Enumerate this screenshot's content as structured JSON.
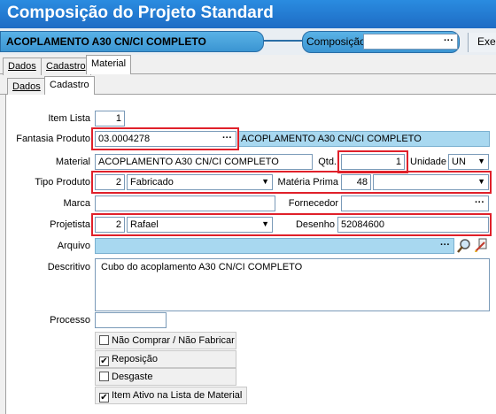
{
  "window": {
    "title": "Composição do Projeto Standard"
  },
  "header": {
    "product_name": "ACOPLAMENTO A30 CN/CI COMPLETO",
    "composicao_label": "Composição",
    "composicao_value": "",
    "composicao_browse": "···",
    "exec_label": "Exec"
  },
  "tabs": {
    "main": [
      "Dados",
      "Cadastro",
      "Material"
    ],
    "sub": [
      "Dados",
      "Cadastro"
    ]
  },
  "form": {
    "item_lista": {
      "label": "Item Lista",
      "value": "1"
    },
    "fantasia_produto": {
      "label": "Fantasia Produto",
      "value": "03.0004278",
      "browse": "···",
      "description": "ACOPLAMENTO A30 CN/CI COMPLETO"
    },
    "material": {
      "label": "Material",
      "value": "ACOPLAMENTO A30 CN/CI COMPLETO"
    },
    "qtd": {
      "label": "Qtd.",
      "value": "1"
    },
    "unidade": {
      "label": "Unidade",
      "value": "UN"
    },
    "tipo_produto": {
      "label": "Tipo Produto",
      "code": "2",
      "value": "Fabricado"
    },
    "materia_prima": {
      "label": "Matéria Prima",
      "code": "48",
      "value": ""
    },
    "marca": {
      "label": "Marca",
      "value": ""
    },
    "fornecedor": {
      "label": "Fornecedor",
      "value": "",
      "browse": "···"
    },
    "projetista": {
      "label": "Projetista",
      "code": "2",
      "value": "Rafael"
    },
    "desenho": {
      "label": "Desenho",
      "value": "52084600"
    },
    "arquivo": {
      "label": "Arquivo",
      "value": "",
      "browse": "···"
    },
    "descritivo": {
      "label": "Descritivo",
      "value": "Cubo do acoplamento A30 CN/CI COMPLETO"
    },
    "processo": {
      "label": "Processo",
      "value": ""
    }
  },
  "checkboxes": [
    {
      "label": "Não Comprar / Não Fabricar",
      "checked": false,
      "mark": ""
    },
    {
      "label": "Reposição",
      "checked": true,
      "mark": "✔"
    },
    {
      "label": "Desgaste",
      "checked": false,
      "mark": ""
    },
    {
      "label": "Item Ativo na Lista de Material",
      "checked": true,
      "mark": "✔"
    }
  ],
  "colors": {
    "title_bar": "#1e6cc4",
    "banner": "#3b95d2",
    "highlight_field": "#a8d8f0",
    "annotation_red": "#e0202a"
  }
}
